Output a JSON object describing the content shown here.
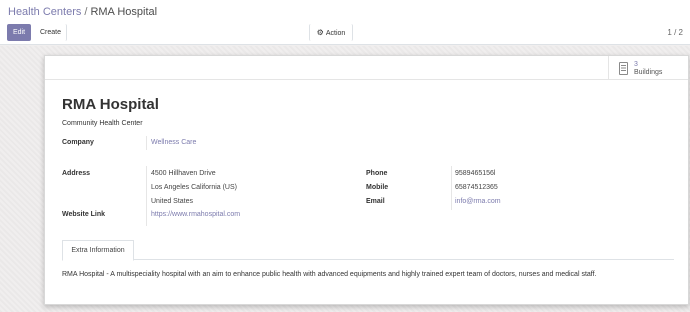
{
  "breadcrumb": {
    "parent": "Health Centers",
    "separator": "/",
    "current": "RMA Hospital"
  },
  "toolbar": {
    "edit_label": "Edit",
    "create_label": "Create",
    "action_label": "Action"
  },
  "pager": {
    "value": "1 / 2"
  },
  "smart_button": {
    "value": "3",
    "label": "Buildings"
  },
  "record": {
    "name": "RMA Hospital",
    "type": "Community Health Center",
    "company_label": "Company",
    "company": "Wellness Care",
    "address_label": "Address",
    "address_line1": "4500 Hillhaven Drive",
    "address_line2": "Los Angeles  California (US)",
    "address_line3": "United States",
    "website_label": "Website Link",
    "website": "https://www.rmahospital.com",
    "phone_label": "Phone",
    "phone": "9589465156l",
    "mobile_label": "Mobile",
    "mobile": "65874512365",
    "email_label": "Email",
    "email": "info@rma.com"
  },
  "notebook": {
    "tabs": [
      "Extra Information"
    ],
    "content": "RMA Hospital -  A multispeciality hospital with an aim to enhance public health with advanced equipments and highly trained expert team of doctors, nurses and medical staff."
  },
  "colors": {
    "accent": "#7c7bad",
    "background": "#f0eeee",
    "sheet": "#ffffff"
  },
  "icons": {
    "action": "gear-icon",
    "smart_button": "building-icon"
  }
}
